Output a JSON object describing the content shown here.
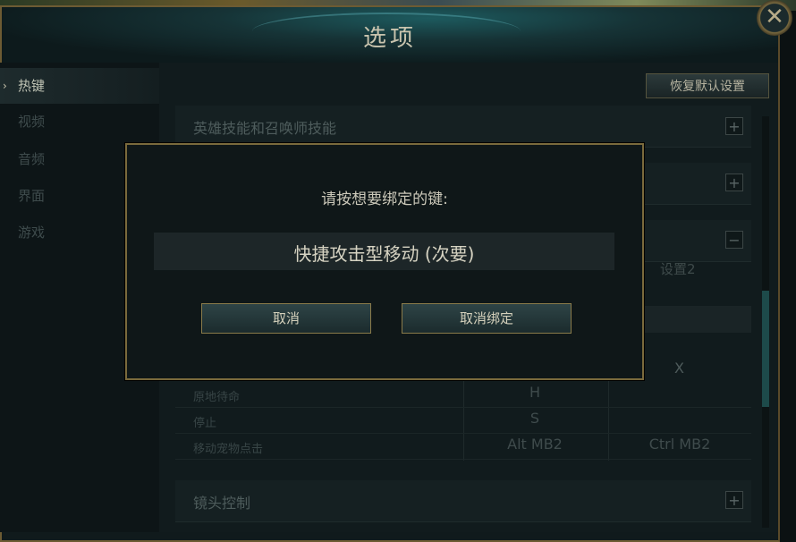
{
  "window": {
    "title": "选项",
    "close_glyph": "✕"
  },
  "sidebar": {
    "items": [
      {
        "label": "热键",
        "active": true
      },
      {
        "label": "视频",
        "active": false
      },
      {
        "label": "音频",
        "active": false
      },
      {
        "label": "界面",
        "active": false
      },
      {
        "label": "游戏",
        "active": false
      }
    ]
  },
  "content": {
    "reset_label": "恢复默认设置",
    "sections": [
      {
        "label": "英雄技能和召唤师技能",
        "toggle": "+"
      },
      {
        "label": "",
        "toggle": "+"
      },
      {
        "label": "",
        "toggle": "−"
      },
      {
        "label": "镜头控制",
        "toggle": "+"
      }
    ],
    "column_header_2": "设置2",
    "x_key": "X",
    "rows": [
      {
        "label": "原地待命",
        "key1": "H",
        "key2": ""
      },
      {
        "label": "停止",
        "key1": "S",
        "key2": ""
      },
      {
        "label": "移动宠物点击",
        "key1": "Alt  MB2",
        "key2": "Ctrl  MB2"
      }
    ]
  },
  "modal": {
    "prompt": "请按想要绑定的键:",
    "action": "快捷攻击型移动 (次要)",
    "cancel_label": "取消",
    "unbind_label": "取消绑定"
  }
}
